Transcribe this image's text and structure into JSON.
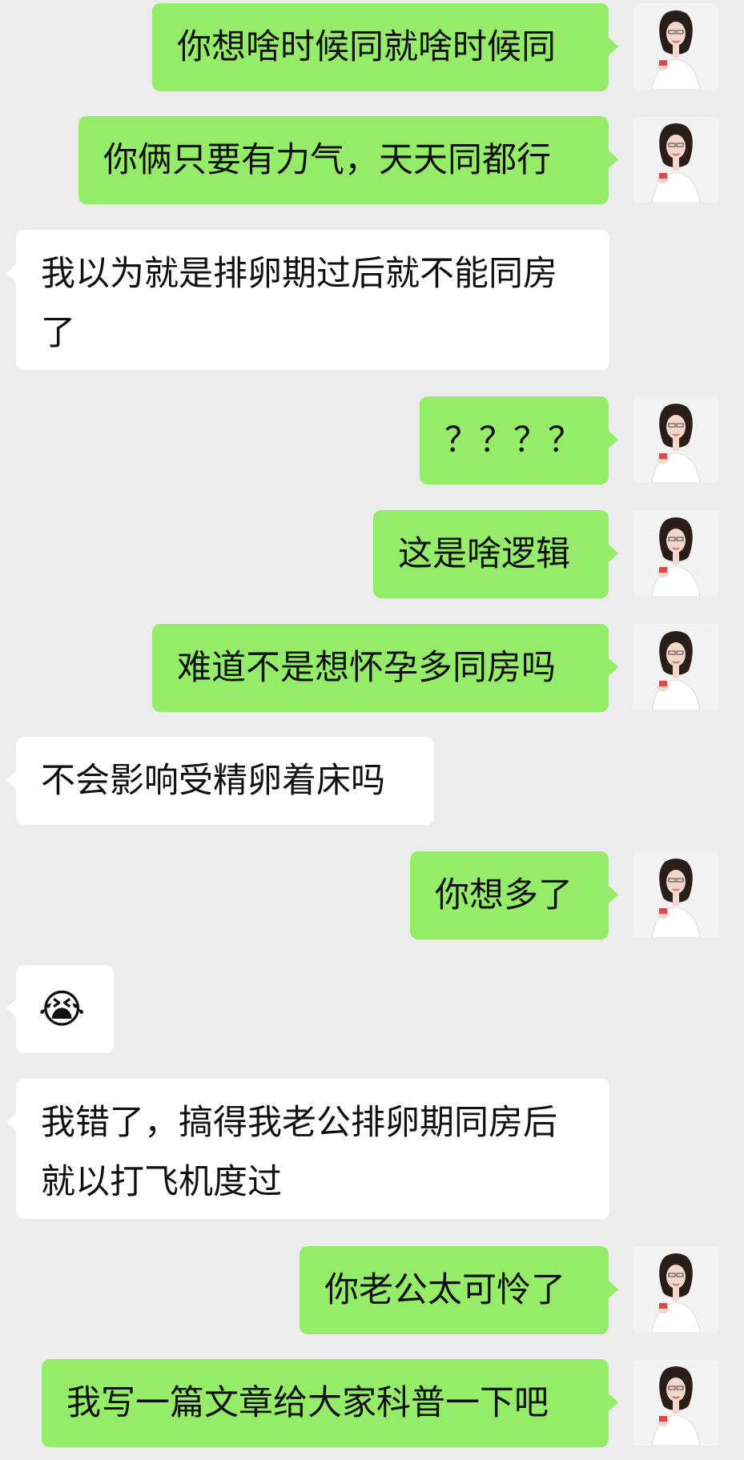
{
  "colors": {
    "background": "#ececec",
    "outgoing_bubble": "#95ec69",
    "incoming_bubble": "#ffffff"
  },
  "messages": [
    {
      "side": "right",
      "text": "你想啥时候同就啥时候同"
    },
    {
      "side": "right",
      "text": "你俩只要有力气，天天同都行"
    },
    {
      "side": "left",
      "text": "我以为就是排卵期过后就不能同房了"
    },
    {
      "side": "right",
      "text": "？？？？"
    },
    {
      "side": "right",
      "text": "这是啥逻辑"
    },
    {
      "side": "right",
      "text": "难道不是想怀孕多同房吗"
    },
    {
      "side": "left",
      "text": "不会影响受精卵着床吗"
    },
    {
      "side": "right",
      "text": "你想多了"
    },
    {
      "side": "left",
      "text": "😭",
      "icon": "crying-emoji"
    },
    {
      "side": "left",
      "text": "我错了，搞得我老公排卵期同房后就以打飞机度过"
    },
    {
      "side": "right",
      "text": "你老公太可怜了"
    },
    {
      "side": "right",
      "text": "我写一篇文章给大家科普一下吧"
    }
  ],
  "avatar": {
    "icon": "doctor-avatar-icon"
  }
}
